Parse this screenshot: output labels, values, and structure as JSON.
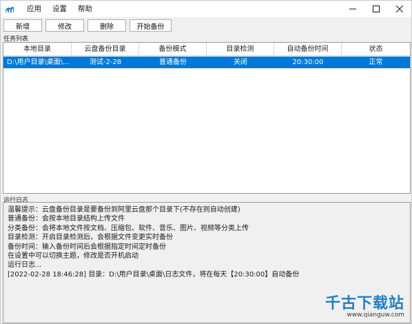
{
  "menu": {
    "items": [
      "应用",
      "设置",
      "帮助"
    ]
  },
  "toolbar": {
    "add": "新增",
    "edit": "修改",
    "delete": "删除",
    "start": "开始备份"
  },
  "task_list": {
    "label": "任务列表",
    "columns": [
      "本地目录",
      "云盘备份目录",
      "备份模式",
      "目录检测",
      "自动备份时间",
      "状态"
    ],
    "rows": [
      [
        "D:\\用户目录\\桌面\\...",
        "测试-2-28",
        "普通备份",
        "关闭",
        "20:30:00",
        "正常"
      ]
    ]
  },
  "log": {
    "label": "运行日志",
    "lines": [
      "温馨提示：云盘备份目录是要备份到阿里云盘那个目录下(不存在则自动创建)",
      "普通备份：会按本地目录结构上传文件",
      "分类备份：会将本地文件按文档、压缩包、软件、音乐、图片、视频等分类上传",
      "目录检测：开启目录检测后，会根据文件变更实时备份",
      "备份时间：输入备份时间后会根据指定时间定时备份",
      "在设置中可以切换主题，修改是否开机启动",
      "运行日志...",
      "[2022-02-28 18:46:28] 目录：D:\\用户目录\\桌面\\日志文件，将在每天【20:30:00】自动备份"
    ]
  },
  "watermark": {
    "title": "千古下载站",
    "url": "www.qianguw.com"
  },
  "colors": {
    "selection": "#0078d7",
    "watermark": "#1f7fc8"
  }
}
